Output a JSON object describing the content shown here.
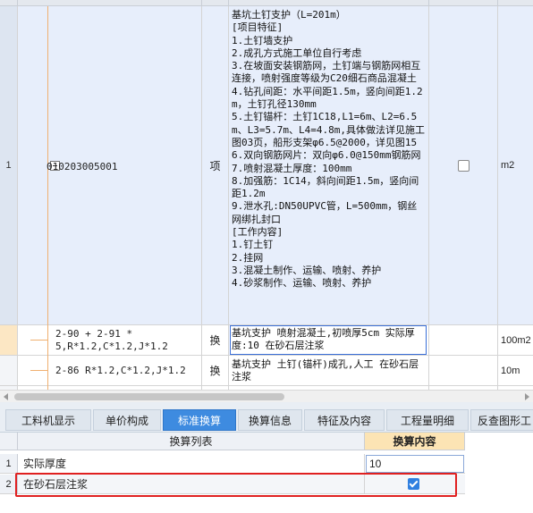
{
  "grid": {
    "rows": [
      {
        "num": "1",
        "code": "010203005001",
        "type": "项",
        "description_lines": [
          "基坑土钉支护（L=201m）",
          "[项目特征]",
          "1.土钉墙支护",
          "2.成孔方式施工单位自行考虑",
          "3.在坡面安装钢筋网，土钉端与钢筋网相互连接，喷射强度等级为C20细石商品混凝土",
          "4.钻孔间距：水平间距1.5m，竖向间距1.2m，土钉孔径130mm",
          "5.土钉锚杆：土钉1C18,L1=6m、L2=6.5m、L3=5.7m、L4=4.8m,具体做法详见施工图03页，船形支架φ6.5@2000，详见图15",
          "6.双向钢筋网片：双向φ6.0@150mm钢筋网",
          "7.喷射混凝土厚度：100mm",
          "8.加强筋：1C14，斜向间距1.5m，竖向间距1.2m",
          "9.泄水孔:DN50UPVC管，L=500mm，钢丝网绑扎封口",
          "[工作内容]",
          "1.钉土钉",
          "2.挂网",
          "3.混凝土制作、运输、喷射、养护",
          "4.砂浆制作、运输、喷射、养护"
        ],
        "checked": false,
        "unit": "m2"
      },
      {
        "num": "",
        "code_line1": "2-90 + 2-91 *",
        "code_line2": "5,R*1.2,C*1.2,J*1.2",
        "type": "换",
        "description": "基坑支护 喷射混凝土,初喷厚5cm  实际厚度:10  在砂石层注浆",
        "unit": "100m2"
      },
      {
        "num": "",
        "code_line1": "2-86 R*1.2,C*1.2,J*1.2",
        "type": "换",
        "description": "基坑支护 土钉(锚杆)成孔,人工  在砂石层注浆",
        "unit": "10m"
      }
    ]
  },
  "tabs": [
    {
      "label": "工料机显示",
      "active": false
    },
    {
      "label": "单价构成",
      "active": false
    },
    {
      "label": "标准换算",
      "active": true
    },
    {
      "label": "换算信息",
      "active": false
    },
    {
      "label": "特征及内容",
      "active": false
    },
    {
      "label": "工程量明细",
      "active": false
    },
    {
      "label": "反查图形工",
      "active": false
    }
  ],
  "conversion_table": {
    "header_list": "换算列表",
    "header_value": "换算内容",
    "rows": [
      {
        "num": "1",
        "name": "实际厚度",
        "value": "10"
      },
      {
        "num": "2",
        "name": "在砂石层注浆",
        "checked": true
      }
    ]
  },
  "colors": {
    "accent": "#3e8be0",
    "highlight_box": "#e02020",
    "header_value_bg": "#fce4b4",
    "tree_line": "#f0b070"
  }
}
